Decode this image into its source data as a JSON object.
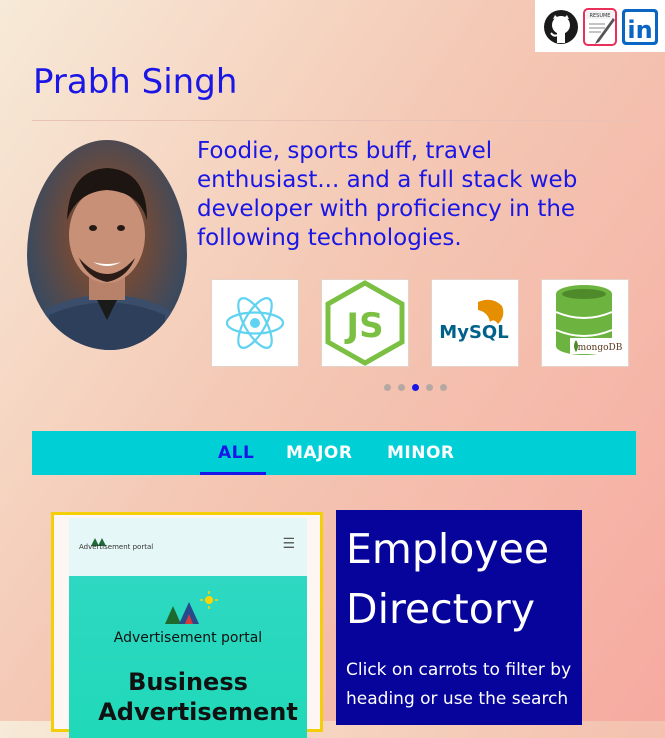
{
  "header": {
    "name": "Prabh Singh",
    "social_icons": [
      "github-icon",
      "resume-icon",
      "linkedin-icon"
    ],
    "resume_label": "RESUME",
    "linkedin_label": "in"
  },
  "bio": {
    "text": "Foodie, sports buff, travel enthusiast... and a full stack web developer with proficiency in the following technologies."
  },
  "tech_carousel": {
    "items": [
      {
        "name": "React",
        "icon": "react-icon"
      },
      {
        "name": "JS",
        "icon": "nodejs-icon",
        "label": "JS"
      },
      {
        "name": "MySQL",
        "icon": "mysql-icon",
        "label": "MySQL"
      },
      {
        "name": "mongoDB",
        "icon": "mongodb-icon",
        "label": "mongoDB"
      }
    ],
    "page_count": 5,
    "active_page": 3
  },
  "tabs": {
    "items": [
      {
        "label": "ALL",
        "active": true
      },
      {
        "label": "MAJOR",
        "active": false
      },
      {
        "label": "MINOR",
        "active": false
      }
    ]
  },
  "projects": [
    {
      "brand": "Advertisement portal",
      "nav_brand": "Advertisement portal",
      "headline_1": "Business",
      "headline_2": "Advertisement"
    },
    {
      "title_1": "Employee",
      "title_2": "Directory",
      "subtitle_1": "Click on carrots to filter by",
      "subtitle_2": "heading or use the search"
    }
  ],
  "colors": {
    "accent": "#1a16e6",
    "tab_bar": "#00cfd6",
    "highlight_border": "#f4cf08",
    "employee_bg": "#06049a"
  }
}
